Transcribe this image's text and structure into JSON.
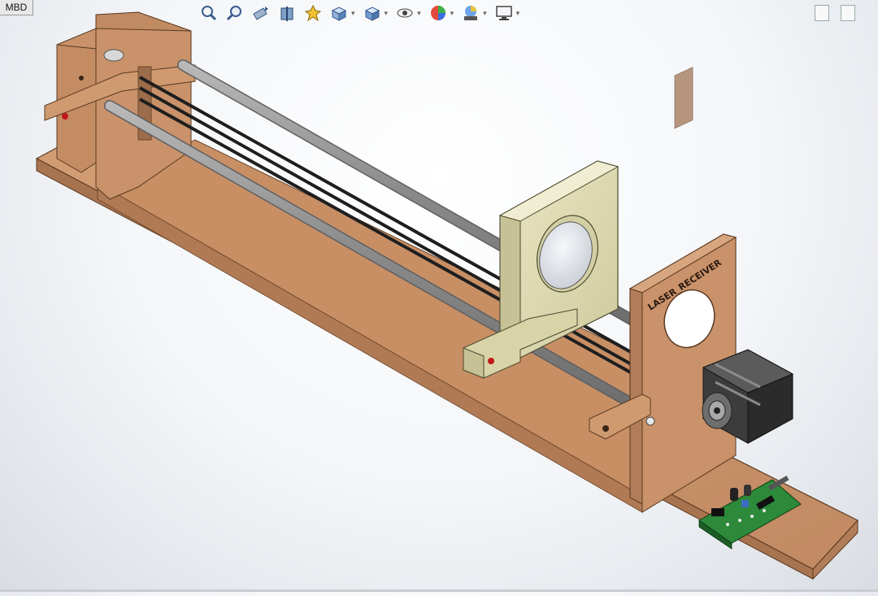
{
  "app": {
    "mbd_tab_label": "MBD"
  },
  "toolbar": {
    "icons": [
      "zoom-to-fit-icon",
      "zoom-to-area-icon",
      "previous-view-icon",
      "section-view-icon",
      "dynamic-annotation-icon",
      "view-orientation-icon",
      "display-style-icon",
      "hide-show-icon",
      "edit-appearance-icon",
      "apply-scene-icon",
      "view-settings-icon"
    ]
  },
  "model": {
    "receiver_label": "LASER_RECEIVER"
  },
  "colors": {
    "wood": "#c9926a",
    "wood_dark": "#a8734f",
    "holder": "#ddd9b0",
    "rod_gray": "#8f8f8f",
    "belt_black": "#1e1e1e",
    "pcb_green": "#2d8a3a"
  }
}
